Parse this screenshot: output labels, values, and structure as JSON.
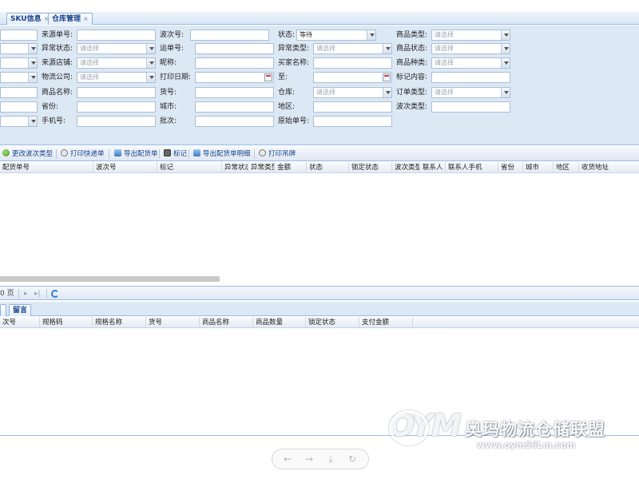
{
  "tabs": [
    {
      "label": "SKU信息",
      "close": "×"
    },
    {
      "label": "仓库管理",
      "close": "×"
    }
  ],
  "form": {
    "col1": [
      {
        "value": "",
        "placeholder": ""
      },
      {
        "value": "",
        "placeholder": ""
      },
      {
        "value": "",
        "placeholder": ""
      },
      {
        "value": "",
        "placeholder": ""
      },
      {
        "value": "",
        "placeholder": ""
      },
      {
        "value": "",
        "placeholder": ""
      },
      {
        "value": "",
        "placeholder": ""
      }
    ],
    "col2": [
      {
        "label": "来源单号:",
        "value": ""
      },
      {
        "label": "异常状态:",
        "value": "请选择"
      },
      {
        "label": "来源店铺:",
        "value": "请选择"
      },
      {
        "label": "物流公司:",
        "value": "请选择"
      },
      {
        "label": "商品名称:",
        "value": ""
      },
      {
        "label": "省份:",
        "value": ""
      },
      {
        "label": "手机号:",
        "value": ""
      }
    ],
    "col3": [
      {
        "label": "波次号:",
        "value": ""
      },
      {
        "label": "运单号:",
        "value": ""
      },
      {
        "label": "昵称:",
        "value": ""
      },
      {
        "label": "打印日期:",
        "value": ""
      },
      {
        "label": "货号:",
        "value": ""
      },
      {
        "label": "城市:",
        "value": ""
      },
      {
        "label": "批次:",
        "value": ""
      }
    ],
    "col4": [
      {
        "label": "状态:",
        "value": "等待"
      },
      {
        "label": "异常类型:",
        "value": "请选择"
      },
      {
        "label": "买家名称:",
        "value": ""
      },
      {
        "label": "至:",
        "value": ""
      },
      {
        "label": "仓库:",
        "value": "请选择"
      },
      {
        "label": "地区:",
        "value": ""
      },
      {
        "label": "原始单号:",
        "value": ""
      }
    ],
    "col5": [
      {
        "label": "商品类型:",
        "value": "请选择"
      },
      {
        "label": "商品状态:",
        "value": "请选择"
      },
      {
        "label": "商品种类:",
        "value": "请选择"
      },
      {
        "label": "标记内容:",
        "value": ""
      },
      {
        "label": "订单类型:",
        "value": "请选择"
      },
      {
        "label": "波次类型:",
        "value": ""
      }
    ]
  },
  "toolbar": [
    {
      "label": "更改波次类型",
      "icon": "change-type-icon"
    },
    {
      "label": "打印快递单",
      "icon": "print-icon"
    },
    {
      "label": "导出配货单",
      "icon": "export-icon"
    },
    {
      "label": "标记",
      "icon": "mark-icon"
    },
    {
      "label": "导出配货单明细",
      "icon": "export-icon"
    },
    {
      "label": "打印吊牌",
      "icon": "print-icon"
    }
  ],
  "grid": {
    "columns": [
      "配货单号",
      "波次号",
      "标记",
      "异常状态",
      "异常类型",
      "金额",
      "状态",
      "锁定状态",
      "波次类型",
      "联系人",
      "联系人手机",
      "省份",
      "城市",
      "地区",
      "收货地址"
    ]
  },
  "pager": {
    "page_suffix": "0 页",
    "next": "▸",
    "last": "▸|"
  },
  "subtabs": [
    {
      "label": "留言"
    }
  ],
  "detail_grid": {
    "columns": [
      "次号",
      "规格码",
      "规格名称",
      "货号",
      "商品名称",
      "商品数量",
      "锁定状态",
      "支付金额"
    ]
  },
  "viewer": {
    "prev": "←",
    "next": "→",
    "download": "⤓",
    "rotate": "↻"
  },
  "watermark": {
    "logo": "OYM",
    "title": "奥玛物流仓储联盟",
    "url": "www.oym56Lm.com"
  }
}
